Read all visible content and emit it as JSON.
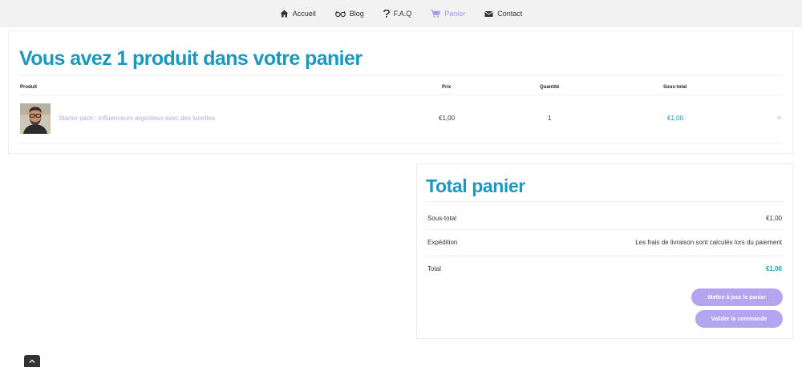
{
  "nav": {
    "items": [
      {
        "label": "Accueil",
        "icon": "home-icon"
      },
      {
        "label": "Blog",
        "icon": "glasses-icon"
      },
      {
        "label": "F.A.Q",
        "icon": "question-icon"
      },
      {
        "label": "Panier",
        "icon": "cart-icon",
        "active": true
      },
      {
        "label": "Contact",
        "icon": "envelope-icon"
      }
    ]
  },
  "cart": {
    "title": "Vous avez 1 produit dans votre panier",
    "headers": {
      "product": "Produit",
      "price": "Prix",
      "quantity": "Quantité",
      "subtotal": "Sous-total"
    },
    "rows": [
      {
        "name": "Starter pack : influenceurs argenteux avec des lunettes",
        "price": "€1,00",
        "quantity": "1",
        "subtotal": "€1,00",
        "remove": "×"
      }
    ]
  },
  "totals": {
    "title": "Total panier",
    "subtotal_label": "Sous-total",
    "subtotal_value": "€1,00",
    "shipping_label": "Expédition",
    "shipping_value": "Les frais de livraison sont calculés lors du paiement",
    "total_label": "Total",
    "total_value": "€1,00",
    "update_button": "Mettre à jour le panier",
    "checkout_button": "Valider la commande"
  },
  "colors": {
    "accent": "#1a98c0",
    "button": "#b3a5ef",
    "link": "#b3aaf0"
  }
}
